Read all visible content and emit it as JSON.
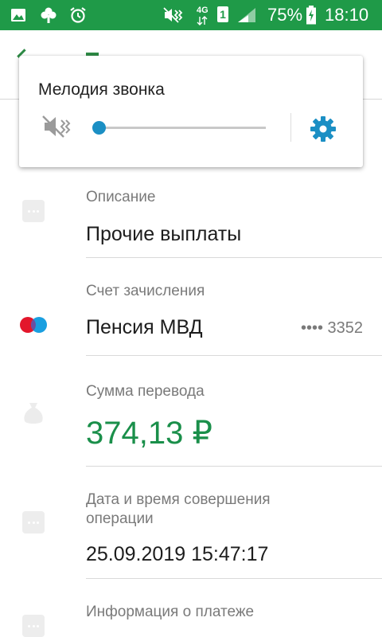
{
  "status_bar": {
    "battery": "75%",
    "time": "18:10",
    "network": "4G",
    "sim_slot": "1",
    "icons": [
      "gallery-icon",
      "app-icon",
      "alarm-icon",
      "vibrate-icon",
      "network-4g-icon",
      "sim-icon",
      "signal-icon",
      "battery-charging-icon"
    ]
  },
  "volume_panel": {
    "title": "Мелодия звонка",
    "level_fraction": 0.0,
    "icons": [
      "mute-speaker-icon",
      "gear-icon"
    ],
    "accent_color": "#1b8fc4"
  },
  "details": {
    "description": {
      "label": "Описание",
      "value": "Прочие выплаты"
    },
    "account": {
      "label": "Счет зачисления",
      "value": "Пенсия МВД",
      "card_mask": "•••• 3352"
    },
    "amount": {
      "label": "Сумма перевода",
      "value": "374,13 ₽"
    },
    "datetime": {
      "label_line1": "Дата и время совершения",
      "label_line2": "операции",
      "value": "25.09.2019 15:47:17"
    },
    "payment_info": {
      "label": "Информация о платеже"
    }
  },
  "colors": {
    "status_bar": "#1f9a48",
    "amount_green": "#1a8f4a",
    "label_gray": "#7a7a7a"
  }
}
